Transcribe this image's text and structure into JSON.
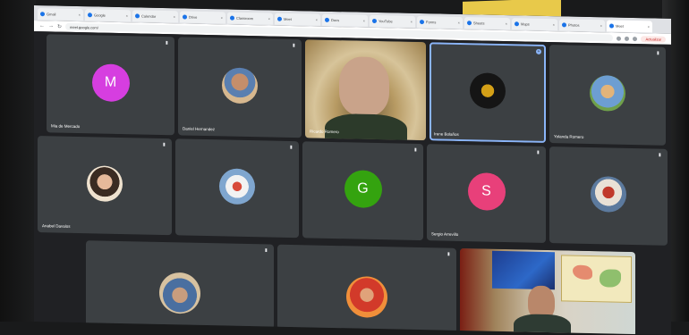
{
  "browser": {
    "tabs": [
      "Gmail",
      "Google",
      "Calendar",
      "Drive",
      "Classroom",
      "Meet",
      "Docs",
      "YouTube",
      "Forms",
      "Sheets",
      "Maps",
      "Photos",
      "Meet"
    ],
    "url": "meet.google.com/",
    "update_label": "Actualizar"
  },
  "meeting": {
    "participants": [
      {
        "name": "Mia de Mercado",
        "type": "letter",
        "letter": "M",
        "color": "#d63ee0"
      },
      {
        "name": "Daniel Hernandez",
        "type": "photo"
      },
      {
        "name": "Ricardo Romero",
        "type": "video"
      },
      {
        "name": "Irene Bolaños",
        "type": "photo"
      },
      {
        "name": "Yolanda Romero",
        "type": "photo"
      },
      {
        "name": "Anabel Davalos",
        "type": "photo"
      },
      {
        "name": "",
        "type": "photo"
      },
      {
        "name": "",
        "type": "letter",
        "letter": "G",
        "color": "#34a30f"
      },
      {
        "name": "Sergio Arrevillo",
        "type": "letter",
        "letter": "S",
        "color": "#e8407a"
      },
      {
        "name": "",
        "type": "photo"
      },
      {
        "name": "",
        "type": "photo"
      },
      {
        "name": "",
        "type": "photo"
      },
      {
        "name": "",
        "type": "video"
      }
    ]
  },
  "colors": {
    "tile_bg": "#3c4043",
    "stage_bg": "#202124",
    "speaking_border": "#8ab4f8"
  },
  "icons": {
    "mute": "mic-off-icon",
    "pin": "pin-icon"
  }
}
